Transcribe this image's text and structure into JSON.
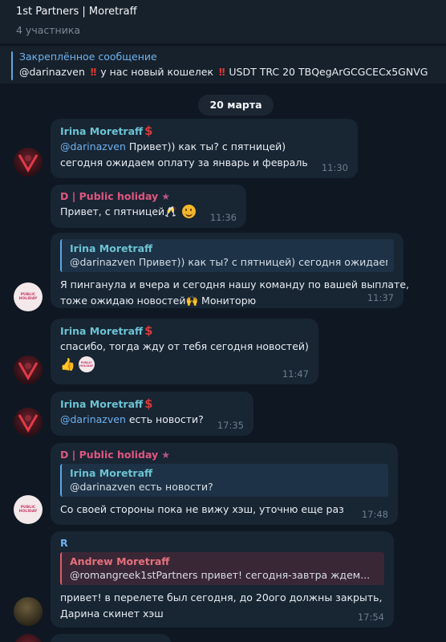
{
  "header": {
    "title": "1st Partners | Moretraff",
    "subtitle": "4 участника"
  },
  "pinned": {
    "label": "Закреплённое сообщение",
    "mention": "@darinazven",
    "text": "у нас новый кошелек",
    "after": "USDT TRC 20 TBQegArGCGCECx5GNVG"
  },
  "date_divider": "20 марта",
  "messages": [
    {
      "sender": "Irina Moretraff",
      "mention": "@darinazven",
      "line1": " Привет)) как ты? с пятницей)",
      "line2": "сегодня ожидаем оплату за январь и февраль",
      "time": "11:30"
    },
    {
      "sender": "D | Public holiday",
      "text": "Привет, с пятницей",
      "glass_emoji": "🥂",
      "time": "11:36"
    },
    {
      "reply_to": "Irina Moretraff",
      "reply_text": "@darinazven Привет)) как ты? с пятницей) сегодня ожидаем ...",
      "line1": "Я пинганула и вчера и сегодня нашу команду по вашей выплате,",
      "line2": "тоже ожидаю новостей",
      "hands_emoji": "🙌",
      "line2_end": " Мониторю",
      "time": "11:37"
    },
    {
      "sender": "Irina Moretraff",
      "text": "спасибо, тогда жду от тебя сегодня новостей)",
      "thumb_emoji": "👍",
      "time": "11:47"
    },
    {
      "sender": "Irina Moretraff",
      "mention": "@darinazven",
      "text": " есть новости?",
      "time": "17:35"
    },
    {
      "sender": "D | Public holiday",
      "reply_to": "Irina Moretraff",
      "reply_text": "@darinazven есть новости?",
      "text": "Со своей стороны пока не вижу хэш, уточню еще раз",
      "time": "17:48"
    },
    {
      "sender": "R",
      "reply_to": "Andrew Moretraff",
      "reply_text": "@romangreek1stPartners привет! сегодня-завтра ждем...",
      "line1": "привет! в перелете был сегодня, до 20ого должны закрыть,",
      "line2": "Дарина скинет хэш",
      "time": "17:54"
    }
  ],
  "avatars": {
    "public_holiday_text": "PUBLIC HOLIDAY"
  },
  "colors": {
    "background": "#0f1822",
    "bubble": "#182533",
    "accent": "#6fb2ef",
    "irina": "#6cc3d2",
    "public_holiday": "#e0567f"
  }
}
